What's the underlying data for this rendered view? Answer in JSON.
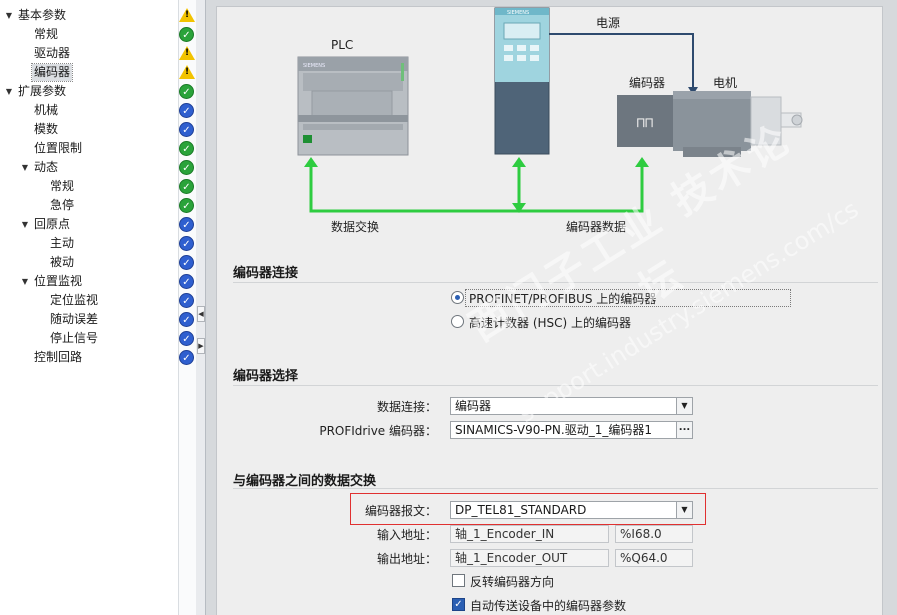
{
  "tree": {
    "items": [
      {
        "label": "基本参数",
        "level": 0,
        "expanded": true,
        "status": "warn"
      },
      {
        "label": "常规",
        "level": 1,
        "status": "ok"
      },
      {
        "label": "驱动器",
        "level": 1,
        "status": "warn"
      },
      {
        "label": "编码器",
        "level": 1,
        "status": "warn",
        "selected": true
      },
      {
        "label": "扩展参数",
        "level": 0,
        "expanded": true,
        "status": "ok"
      },
      {
        "label": "机械",
        "level": 1,
        "status": "info"
      },
      {
        "label": "模数",
        "level": 1,
        "status": "info"
      },
      {
        "label": "位置限制",
        "level": 1,
        "status": "ok"
      },
      {
        "label": "动态",
        "level": 1,
        "expanded": true,
        "status": "ok"
      },
      {
        "label": "常规",
        "level": 2,
        "status": "ok"
      },
      {
        "label": "急停",
        "level": 2,
        "status": "ok"
      },
      {
        "label": "回原点",
        "level": 1,
        "expanded": true,
        "status": "info"
      },
      {
        "label": "主动",
        "level": 2,
        "status": "info"
      },
      {
        "label": "被动",
        "level": 2,
        "status": "info"
      },
      {
        "label": "位置监视",
        "level": 1,
        "expanded": true,
        "status": "info"
      },
      {
        "label": "定位监视",
        "level": 2,
        "status": "info"
      },
      {
        "label": "随动误差",
        "level": 2,
        "status": "info"
      },
      {
        "label": "停止信号",
        "level": 2,
        "status": "info"
      },
      {
        "label": "控制回路",
        "level": 1,
        "status": "info"
      }
    ]
  },
  "diagram": {
    "plc_label": "PLC",
    "power_label": "电源",
    "encoder_label": "编码器",
    "motor_label": "电机",
    "data_exchange_label": "数据交换",
    "encoder_data_label": "编码器数据",
    "plc_brand": "SIEMENS",
    "drive_brand": "SIEMENS",
    "link_color": "#2ecc40"
  },
  "encoder_connection": {
    "title": "编码器连接",
    "options": [
      {
        "label": "PROFINET/PROFIBUS 上的编码器",
        "selected": true
      },
      {
        "label": "高速计数器 (HSC) 上的编码器",
        "selected": false
      }
    ]
  },
  "encoder_selection": {
    "title": "编码器选择",
    "data_connection_label": "数据连接：",
    "data_connection_value": "编码器",
    "profidrive_label": "PROFIdrive 编码器：",
    "profidrive_value": "SINAMICS-V90-PN.驱动_1_编码器1"
  },
  "data_exchange": {
    "title": "与编码器之间的数据交换",
    "telegram_label": "编码器报文：",
    "telegram_value": "DP_TEL81_STANDARD",
    "input_label": "输入地址：",
    "input_value": "轴_1_Encoder_IN",
    "input_address": "%I68.0",
    "output_label": "输出地址：",
    "output_value": "轴_1_Encoder_OUT",
    "output_address": "%Q64.0",
    "invert_label": "反转编码器方向",
    "invert_checked": false,
    "auto_transfer_label": "自动传送设备中的编码器参数",
    "auto_transfer_checked": true
  },
  "watermark": {
    "line1": "西门子工业 技术论坛",
    "line2": "support.industry.siemens.com/cs"
  },
  "colors": {
    "highlight": "#e03030",
    "ok": "#2aa33a",
    "info": "#2f5fcf",
    "warn": "#f2c300"
  }
}
